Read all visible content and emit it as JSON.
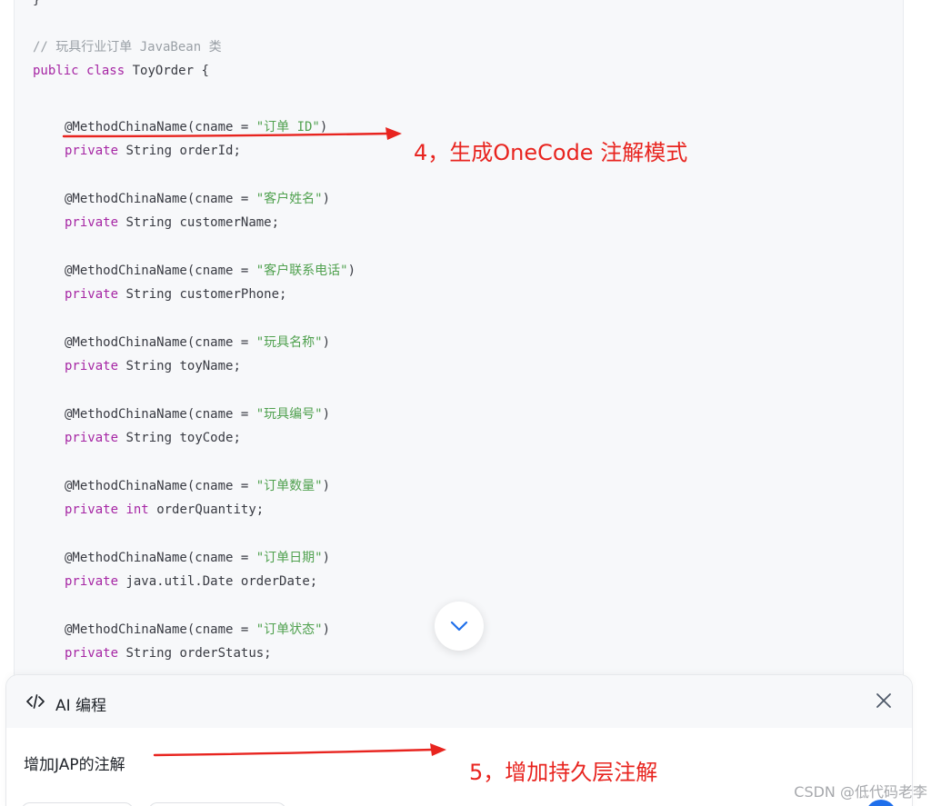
{
  "code": {
    "brace_close": "}",
    "comment": "// 玩具行业订单 JavaBean 类",
    "class_kw1": "public",
    "class_kw2": "class",
    "class_name": "ToyOrder {",
    "annotation_prefix": "@MethodChinaName(cname = ",
    "annotation_suffix": ")",
    "fields": [
      {
        "cname": "\"订单 ID\"",
        "modifier": "private",
        "type": "String",
        "name": "orderId;"
      },
      {
        "cname": "\"客户姓名\"",
        "modifier": "private",
        "type": "String",
        "name": "customerName;"
      },
      {
        "cname": "\"客户联系电话\"",
        "modifier": "private",
        "type": "String",
        "name": "customerPhone;"
      },
      {
        "cname": "\"玩具名称\"",
        "modifier": "private",
        "type": "String",
        "name": "toyName;"
      },
      {
        "cname": "\"玩具编号\"",
        "modifier": "private",
        "type": "String",
        "name": "toyCode;"
      },
      {
        "cname": "\"订单数量\"",
        "modifier": "private",
        "type": "int",
        "name": "orderQuantity;"
      },
      {
        "cname": "\"订单日期\"",
        "modifier": "private",
        "type": "java.util.Date",
        "name": "orderDate;"
      },
      {
        "cname": "\"订单状态\"",
        "modifier": "private",
        "type": "String",
        "name": "orderStatus;"
      }
    ]
  },
  "annotations": {
    "step4": "4，生成OneCode 注解模式",
    "step5": "5，增加持久层注解"
  },
  "ai_panel": {
    "title": "AI 编程",
    "input_text": "增加JAP的注解"
  },
  "watermark": "CSDN @低代码老李",
  "colors": {
    "annotation_red": "#e8241f",
    "keyword": "#a626a4",
    "string": "#50a14f",
    "comment": "#9aa0a6",
    "accent_blue": "#1f6feb"
  }
}
